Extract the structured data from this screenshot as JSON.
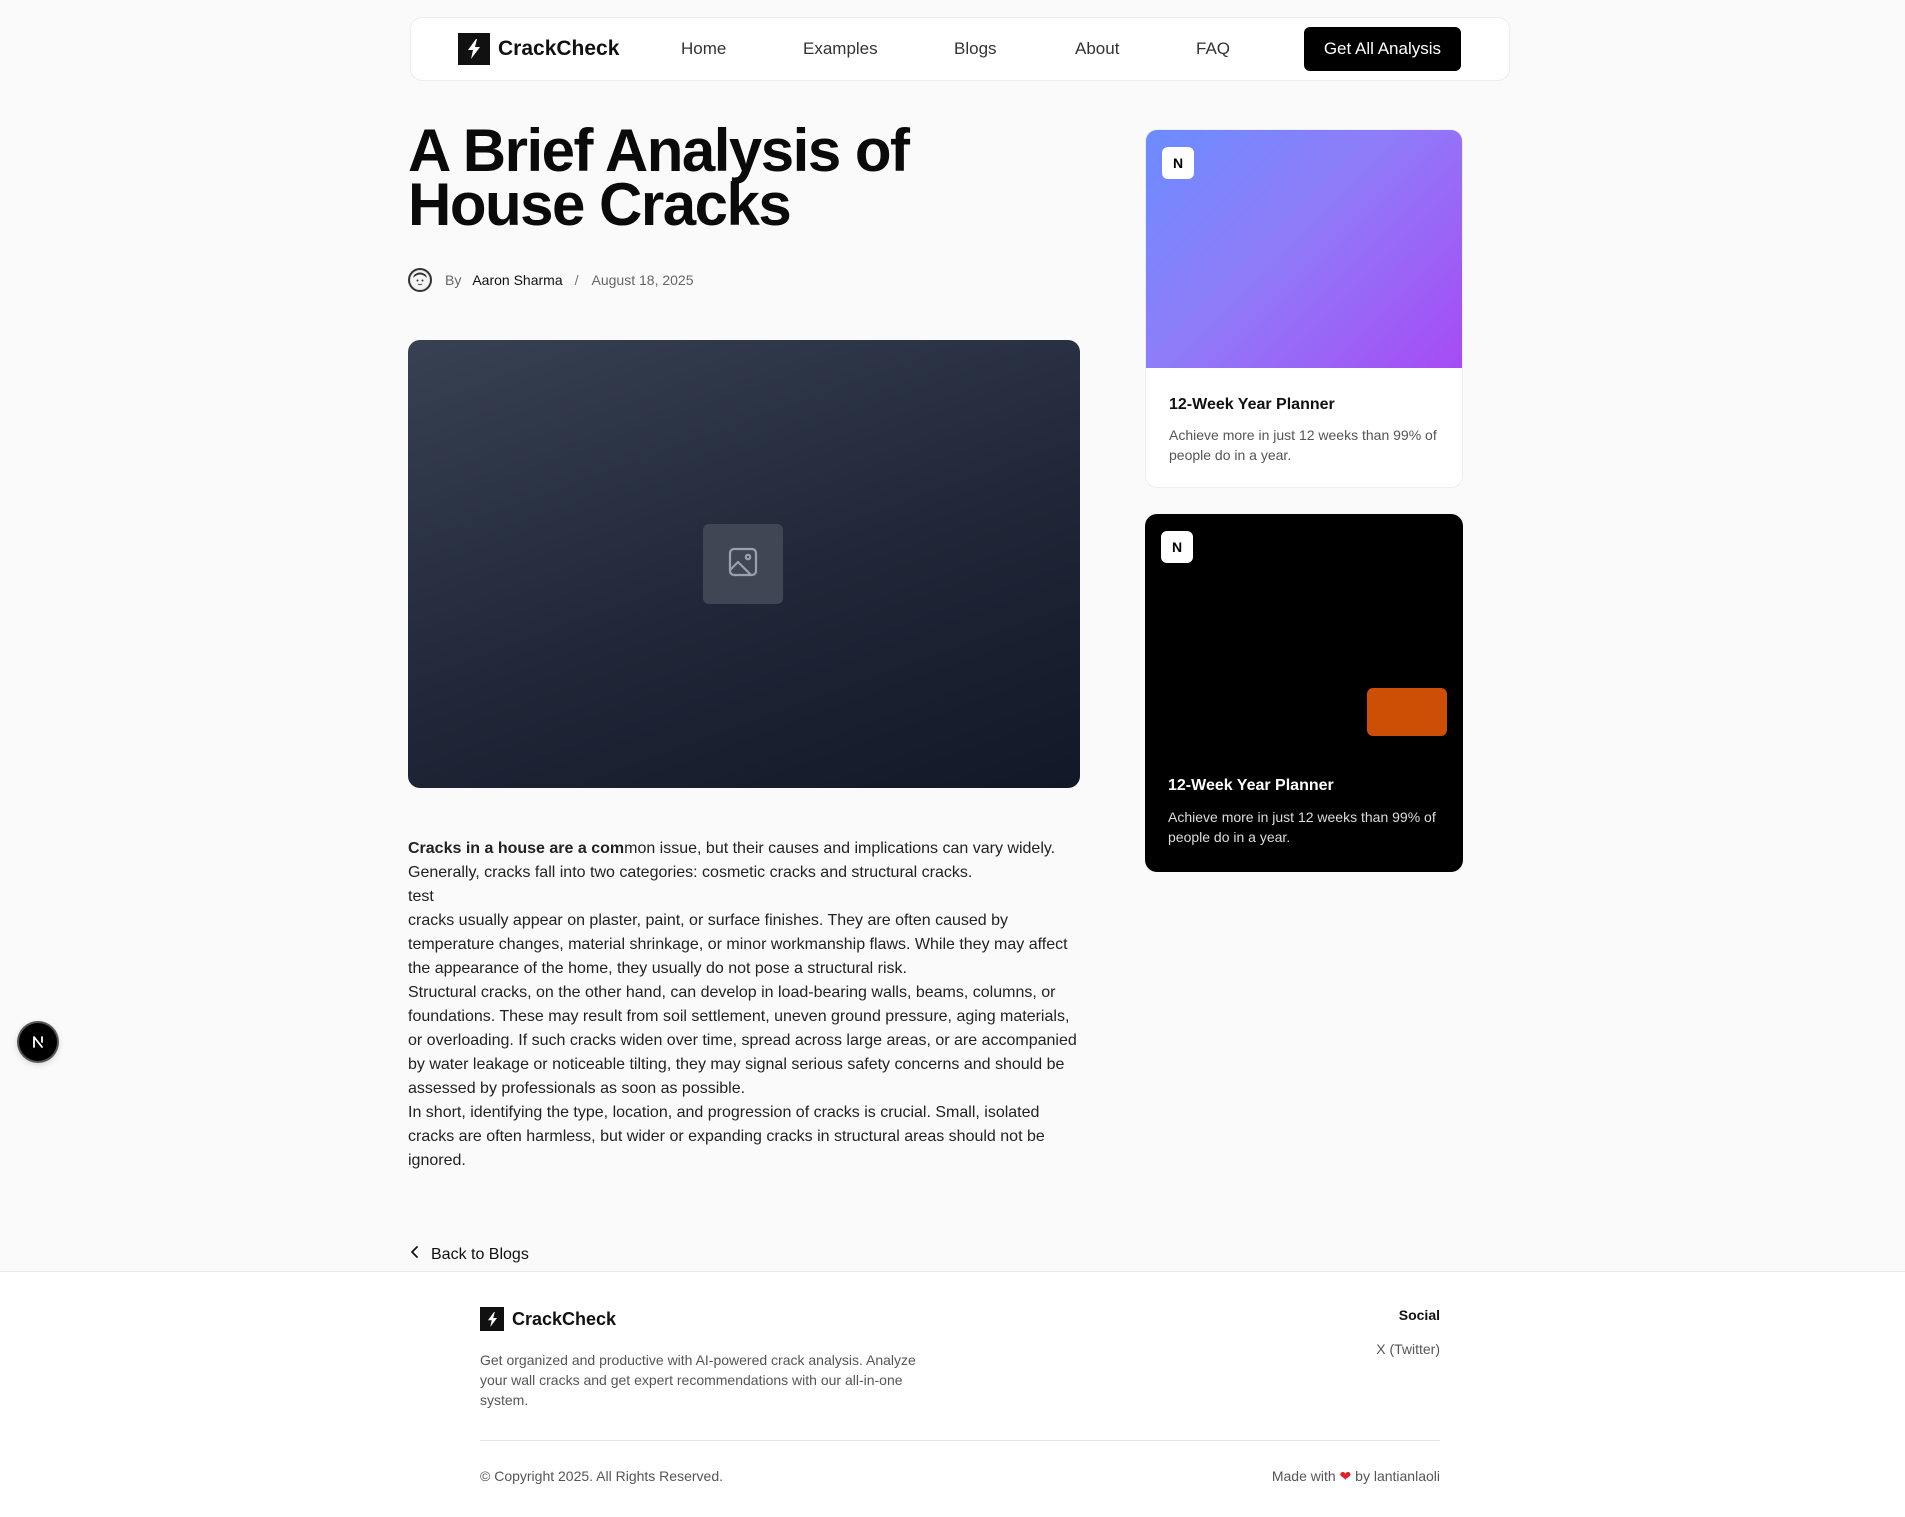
{
  "nav": {
    "brand": "CrackCheck",
    "links": [
      "Home",
      "Examples",
      "Blogs",
      "About",
      "FAQ"
    ],
    "cta": "Get All Analysis"
  },
  "article": {
    "title": "A Brief Analysis of House Cracks",
    "by": "By",
    "author": "Aaron Sharma",
    "separator": "/",
    "date": "August 18, 2025",
    "intro_bold": "Cracks in a house are a com",
    "paragraphs": [
      "mon issue, but their causes and implications can vary widely.",
      "Generally, cracks fall into two categories: cosmetic cracks and structural cracks.",
      "test",
      "cracks usually appear on plaster, paint, or surface finishes. They are often caused by temperature changes, material shrinkage, or minor workmanship flaws. While they may affect the appearance of the home, they usually do not pose a structural risk.",
      "Structural cracks, on the other hand, can develop in load-bearing walls, beams, columns, or foundations. These may result from soil settlement, uneven ground pressure, aging materials, or overloading. If such cracks widen over time, spread across large areas, or are accompanied by water leakage or noticeable tilting, they may signal serious safety concerns and should be assessed by professionals as soon as possible.",
      "In short, identifying the type, location, and progression of cracks is crucial. Small, isolated cracks are often harmless, but wider or expanding cracks in structural areas should not be ignored."
    ],
    "back_label": "Back to Blogs"
  },
  "sidebar": {
    "cards": [
      {
        "badge": "N",
        "title": "12-Week Year Planner",
        "desc": "Achieve more in just 12 weeks than 99% of people do in a year."
      },
      {
        "badge": "N",
        "title": "12-Week Year Planner",
        "desc": "Achieve more in just 12 weeks than 99% of people do in a year."
      }
    ]
  },
  "footer": {
    "brand": "CrackCheck",
    "desc": "Get organized and productive with AI-powered crack analysis. Analyze your wall cracks and get expert recommendations with our all-in-one system.",
    "social_heading": "Social",
    "social_link": "X (Twitter)",
    "copyright": "© Copyright 2025. All Rights Reserved.",
    "made_prefix": "Made with",
    "heart": "❤",
    "made_suffix": "by lantianlaoli"
  },
  "colors": {
    "accent_orange": "#cc4f05",
    "hero_dark": "#1f2738",
    "gradient_start": "#6c8cff",
    "gradient_end": "#a64bf5",
    "heart": "#e11d2e"
  },
  "icons": [
    "bolt-icon",
    "image-icon",
    "chevron-left-icon",
    "avatar-icon",
    "n-badge-icon"
  ]
}
